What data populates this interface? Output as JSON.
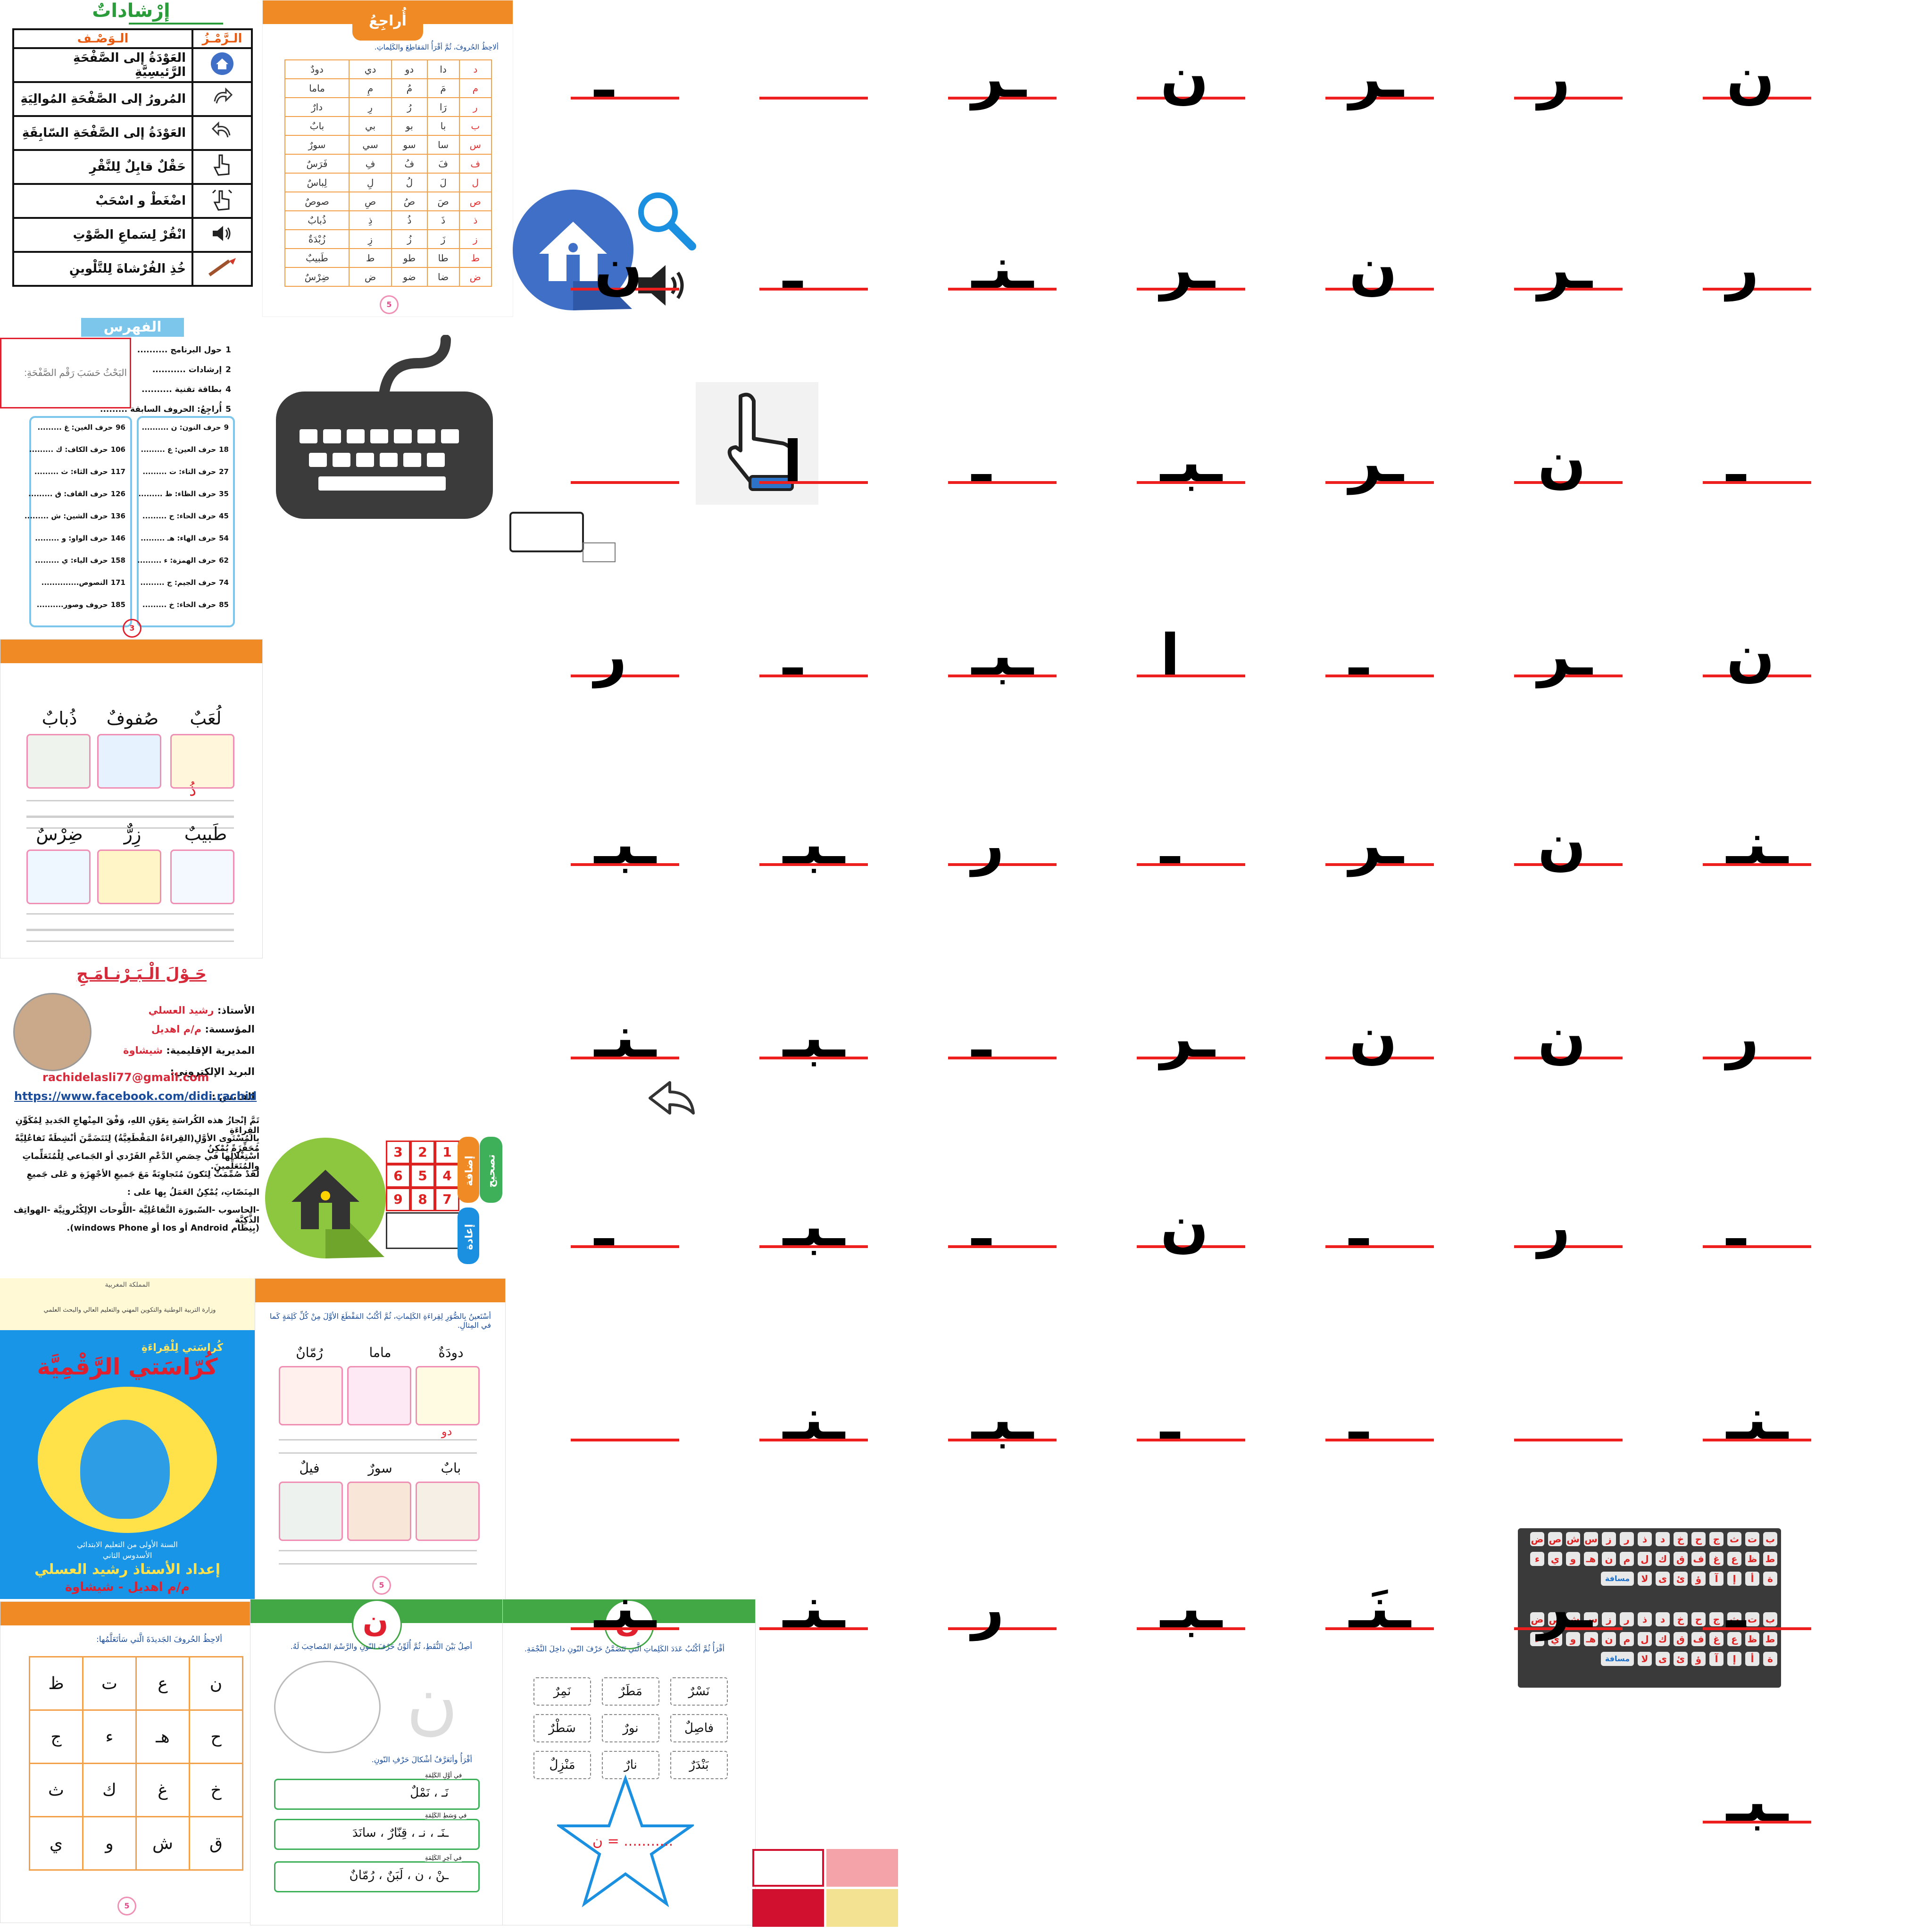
{
  "help": {
    "title": "إرْشاداتٌ",
    "col_symbol": "الـرَّمْـزُ",
    "col_desc": "الـوَصْـف",
    "rows": [
      {
        "icon": "home-icon",
        "text": "العَوْدَةُ إلى الصَّفْحَةِ الرَّئيسِيَّةِ"
      },
      {
        "icon": "forward-arrow-icon",
        "text": "المُرورُ إلى الصَّفْحَةِ المُوالِيَةِ"
      },
      {
        "icon": "back-arrow-icon",
        "text": "العَوْدَةُ إلى الصَّفْحَةِ السّابِقَةِ"
      },
      {
        "icon": "pointing-hand-icon",
        "text": "حَقْلٌ قابِلٌ لِلنَّقْرِ"
      },
      {
        "icon": "drag-hand-icon",
        "text": "اضْغَطْ و اسْحَبْ"
      },
      {
        "icon": "speaker-icon",
        "text": "انْقُرْ لِسَماعِ الصَّوْتِ"
      },
      {
        "icon": "brush-icon",
        "text": "خُذِ الفُرْشاةَ لِلتَّلْوينِ"
      }
    ]
  },
  "review": {
    "title": "أُراجِعُ",
    "instruction": "ألاحِظُ الحُروفَ، ثُمَّ أقْرَأُ المَقاطِعَ والكَلِماتِ.",
    "rows": [
      [
        "د",
        "دا",
        "دو",
        "دي",
        "دودٌ"
      ],
      [
        "م",
        "مَ",
        "مُ",
        "مِ",
        "ماما"
      ],
      [
        "ر",
        "رَا",
        "رُ",
        "رِ",
        "دارٌ"
      ],
      [
        "ب",
        "با",
        "بو",
        "بي",
        "بابٌ"
      ],
      [
        "س",
        "سا",
        "سو",
        "سي",
        "سورٌ"
      ],
      [
        "ف",
        "فَ",
        "فُ",
        "فِ",
        "فَرَسٌ"
      ],
      [
        "ل",
        "لَ",
        "لُ",
        "لِ",
        "لِباسٌ"
      ],
      [
        "ص",
        "صَ",
        "صُ",
        "صِ",
        "صوصٌ"
      ],
      [
        "ذ",
        "ذَ",
        "ذُ",
        "ذِ",
        "ذُبابٌ"
      ],
      [
        "ز",
        "زَ",
        "زُ",
        "زِ",
        "زُبْدَةٌ"
      ],
      [
        "ط",
        "طا",
        "طو",
        "ط",
        "طَبيبٌ"
      ],
      [
        "ض",
        "ضا",
        "ضو",
        "ض",
        "ضِرْسٌ"
      ]
    ]
  },
  "index": {
    "title": "الفهرس",
    "search_placeholder": "البَحْثُ حَسَبَ رَقْمِ الصَّفْحَةِ:",
    "top": [
      {
        "label": "حول البرنامج ..........",
        "page": "1"
      },
      {
        "label": "إرشادات ...........",
        "page": "2"
      },
      {
        "label": "بطاقة تقنية ..........",
        "page": "4"
      },
      {
        "label": "أُراجِعُ: الحروف السابقة .........",
        "page": "5"
      }
    ],
    "right": [
      {
        "label": "حرف النون: ن ..........",
        "page": "9"
      },
      {
        "label": "حرف العين: ع .........",
        "page": "18"
      },
      {
        "label": "حرف التاء: ت .........",
        "page": "27"
      },
      {
        "label": "حرف الظاء: ظ .........",
        "page": "35"
      },
      {
        "label": "حرف الحاء: ح .........",
        "page": "45"
      },
      {
        "label": "حرف الهاء: هـ .........",
        "page": "54"
      },
      {
        "label": "حرف الهمزة: ء .........",
        "page": "62"
      },
      {
        "label": "حرف الجيم: ج .........",
        "page": "74"
      },
      {
        "label": "حرف الخاء: خ .........",
        "page": "85"
      }
    ],
    "left": [
      {
        "label": "حرف الغين: غ .........",
        "page": "96"
      },
      {
        "label": "حرف الكاف: ك .........",
        "page": "106"
      },
      {
        "label": "حرف الثاء: ث .........",
        "page": "117"
      },
      {
        "label": "حرف القاف: ق .........",
        "page": "126"
      },
      {
        "label": "حرف الشين: ش .........",
        "page": "136"
      },
      {
        "label": "حرف الواو: و .........",
        "page": "146"
      },
      {
        "label": "حرف الياء: ي .........",
        "page": "158"
      },
      {
        "label": "النصوص..............",
        "page": "171"
      },
      {
        "label": "حروف وصور..........",
        "page": "185"
      }
    ],
    "page_number": "3"
  },
  "words_page": {
    "top_words": [
      "لُعَبٌ",
      "صُفوفٌ",
      "ذُبابٌ"
    ],
    "bottom_words": [
      "طَبيبٌ",
      "زِرٌّ",
      "ضِرْسٌ"
    ],
    "answer": "ذُ"
  },
  "about": {
    "title": "حَـوْلَ الْـبَـرْنـامَـجِ",
    "teacher_label": "الأستاذ:",
    "teacher": "رشيد العسلي",
    "school_label": "المؤسسة:",
    "school": "م/م اهديل",
    "direction_label": "المديرية الإقليمية:",
    "direction": "شيشاوة",
    "email_label": "البريد الإلكتروني:",
    "email": "rachidelasli77@gmail.com",
    "facebook_label": "الفايس :",
    "facebook": "https://www.facebook.com/didi.rachid",
    "para": [
      "تَمَّ إنْجازُ هذه الكُراسَةِ بِعَوْنِ اللهِ، وَفْقَ المِنْهاجِ الجَديدِ لِمُكَوِّنِ القِراءَةِ",
      "بِالمُسْتَوى الأوَّلِ(القِراءَةُ المَقْطَعِيَّةُ) لِتَتَضَمَّنَ أنْشِطَةً تَفاعُلِيَّةً مُحَفِّزَةً يُمْكِنُ",
      "اسْتِغْلالُها في حِصَصِ الدَّعْمِ الفَرْدي أو الجَماعي لِلْمُتَعَلِّماتِ والمُتَعَلِّمينَ.",
      "لَقَدْ صُمِّمَتْ لِتَكونَ مُتَجاوِبَةً مَعَ جَميعِ الأجْهِزَةِ و عَلى جَميعِ",
      "المِنَصّاتِ، يُمْكِنُ العَمَلُ بِها على :",
      "-الحاسوب -السّبورَة التَّفاعُلِيَّة -اللَّوحات الإلِكْتْرونِيَّة -الهواتِف الذَّكِيَّة",
      "(بِنِظام Android أو Ios أو windows Phone)."
    ]
  },
  "cover": {
    "header_top": "المملكة المغربية",
    "ministry": "وزارة التربية الوطنية والتكوين المهني والتعليم العالي والبحث العلمي",
    "subtitle": "كُراسَتي لِلْقِراءَةِ",
    "title": "كُرّاسَتي الرَّقْمِيَّة",
    "level": "السنة الأولى من التعليم الابتدائي",
    "term": "الأسدوس الثاني",
    "prepared": "إعداد الأستاذ رشيد العسلي",
    "school": "م/م اهديل - شيشاوة"
  },
  "syllable_page": {
    "instruction": "أسْتَعينُ بِالصُّوَرِ لِقِراءَةِ الكَلِماتِ، ثُمَّ أكْتُبُ المَقْطَعَ الأوَّلَ مِنْ كُلِّ كَلِمَةٍ كَما في المِثالِ.",
    "top_words": [
      "دودَةٌ",
      "ماما",
      "رُمّانٌ"
    ],
    "bottom_words": [
      "بابٌ",
      "سورٌ",
      "فيلٌ"
    ],
    "example_answer": "دو"
  },
  "letters_grid": {
    "instruction": "ألاحِظُ الحُروفَ الجَديدَةَ الَّتي سَأتَعَلَّمُها:",
    "rows": [
      [
        "ن",
        "ع",
        "ت",
        "ظ"
      ],
      [
        "ح",
        "هـ",
        "ء",
        "ج"
      ],
      [
        "خ",
        "غ",
        "ك",
        "ث"
      ],
      [
        "ق",
        "ش",
        "و",
        "ي"
      ]
    ]
  },
  "nun_page1": {
    "letter": "ن",
    "step1": "أصِلُ بَيْنَ النُّقَطِ، ثُمَّ أُلَوِّنُ حَرْفَ النّونِ والرَّسْمَ المُصاحِبَ لَهُ.",
    "step2": "أقْرَأُ وأتَعَرَّفُ أشْكالَ حَرْفِ النّونِ.",
    "start_label": "في أوَّلِ الكَلِمَةِ",
    "start_words": "نَـ ، نَمْلٌ",
    "mid_label": "في وَسَطِ الكَلِمَةِ",
    "mid_words": "ـنَـ ، نـ ، قِنّارٌ ، سانَدَ",
    "end_label": "في آخِرِ الكَلِمَةِ",
    "end_words": "ـنْ ، ن ، لَبَنٌ ، رُمّانٌ"
  },
  "nun_page2": {
    "letter": "ن",
    "step3": "أقْرَأُ ثُمَّ أكْتُبُ عَدَدَ الكَلِماتِ الَّتي تَتَضَمَّنُ حَرْفَ النّونِ داخِلَ النَّجْمَةِ.",
    "words": [
      "نَسْرٌ",
      "مَطَرٌ",
      "نَمِرٌ",
      "فاصِلٌ",
      "نورٌ",
      "سَطْرٌ",
      "بَنْدَرٌ",
      "نارٌ",
      "مَنْزِلٌ"
    ],
    "star_text": "ن = ..........."
  },
  "tracing": {
    "glyphs": [
      "ن",
      "ر",
      "ـر",
      "ن",
      "ـر",
      "",
      "ـ",
      "ر",
      "ـر",
      "ن",
      "ـر",
      "ـنـ",
      "ـ",
      "ن",
      "ـ",
      "ن",
      "ـر",
      "ـبـ",
      "ـ",
      "ا",
      "",
      "ن",
      "ـر",
      "ـ",
      "ا",
      "ـبـ",
      "ـ",
      "ر",
      "ـنـ",
      "ن",
      "ـر",
      "ـ",
      "ر",
      "ـبـ",
      "ـبـ",
      "ر",
      "ن",
      "ن",
      "ـر",
      "ـ",
      "ـبـ",
      "ـنـ",
      "ـ",
      "ر",
      "ـ",
      "ن",
      "ـ",
      "ـبـ",
      "ـ",
      "ـنـ",
      "",
      "ـ",
      "ـ",
      "ـبـ",
      "ـنـ",
      "",
      "ـ",
      "ـر",
      "ـنَـ",
      "ـبـ",
      "ر",
      "ـنـ",
      "ـنـ",
      "ـبـ"
    ]
  },
  "keyboard": {
    "row1": [
      "ب",
      "ت",
      "ث",
      "ج",
      "ح",
      "خ",
      "د",
      "ذ",
      "ر",
      "ز",
      "س",
      "ش",
      "ص",
      "ض"
    ],
    "row2": [
      "ط",
      "ظ",
      "ع",
      "غ",
      "ف",
      "ق",
      "ك",
      "ل",
      "م",
      "ن",
      "هـ",
      "و",
      "ي",
      "ء"
    ],
    "row3": [
      "ة",
      "أ",
      "إ",
      "آ",
      "ؤ",
      "ئ",
      "ى",
      "لا",
      "مسافة"
    ],
    "numpad": [
      "1",
      "2",
      "3",
      "4",
      "5",
      "6",
      "7",
      "8",
      "9"
    ],
    "correct_label": "تصحيح",
    "add_label": "إضافة",
    "reset_label": "إعادة"
  },
  "page_badge": "5",
  "colors": {
    "orange": "#f08a24",
    "green": "#42a845",
    "red": "#ee1f1f",
    "blue": "#1b8fe0",
    "pink": "#f08fb4"
  }
}
